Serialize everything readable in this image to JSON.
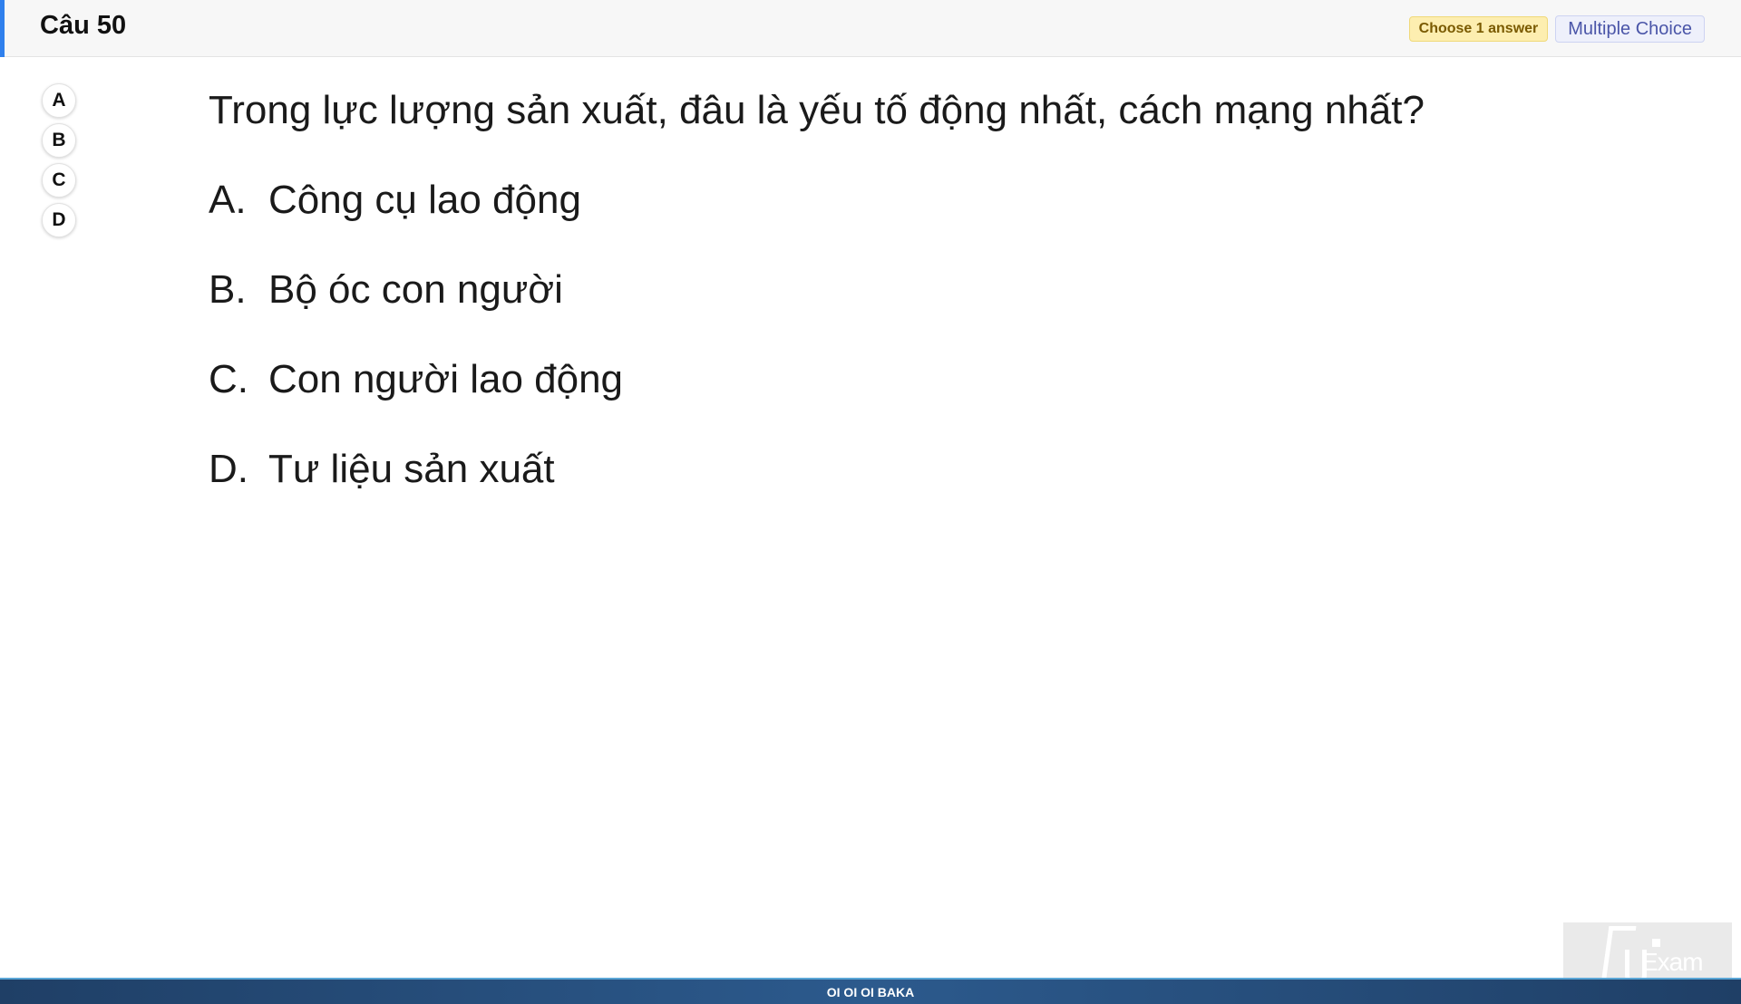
{
  "header": {
    "title": "Câu 50",
    "badge_choose": "Choose 1 answer",
    "badge_type": "Multiple Choice",
    "accent_color": "#2f80ed"
  },
  "answer_buttons": [
    "A",
    "B",
    "C",
    "D"
  ],
  "question": {
    "stem": "Trong lực lượng sản xuất, đâu là yếu tố động nhất, cách mạng nhất?",
    "options": [
      {
        "letter": "A.",
        "text": "Công cụ lao động"
      },
      {
        "letter": "B.",
        "text": "Bộ óc con người"
      },
      {
        "letter": "C.",
        "text": "Con người lao động"
      },
      {
        "letter": "D.",
        "text": "Tư liệu sản xuất"
      }
    ]
  },
  "watermark": {
    "text": "Exam",
    "icon": "fu-logo-icon"
  },
  "footer": {
    "text": "OI OI OI BAKA"
  }
}
